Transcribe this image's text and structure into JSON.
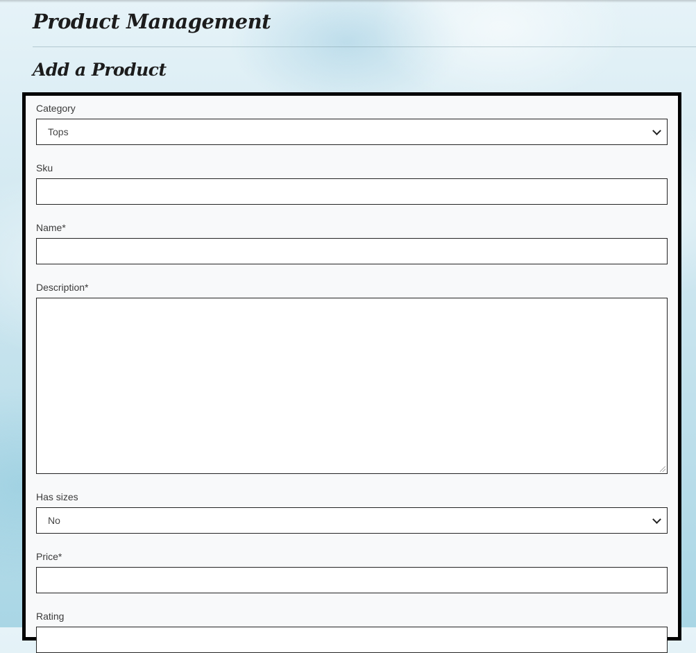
{
  "header": {
    "title": "Product Management",
    "subtitle": "Add a Product"
  },
  "form": {
    "category": {
      "label": "Category",
      "value": "Tops"
    },
    "sku": {
      "label": "Sku",
      "value": ""
    },
    "name": {
      "label": "Name*",
      "value": ""
    },
    "description": {
      "label": "Description*",
      "value": ""
    },
    "has_sizes": {
      "label": "Has sizes",
      "value": "No"
    },
    "price": {
      "label": "Price*",
      "value": ""
    },
    "rating": {
      "label": "Rating",
      "value": ""
    }
  },
  "icons": {
    "select_arrow": "chevron-down-icon",
    "textarea_resize": "resize-grip-icon"
  },
  "colors": {
    "text_dark": "#1c1c1c",
    "form_border": "#000000",
    "form_background": "#f8f9fa"
  }
}
